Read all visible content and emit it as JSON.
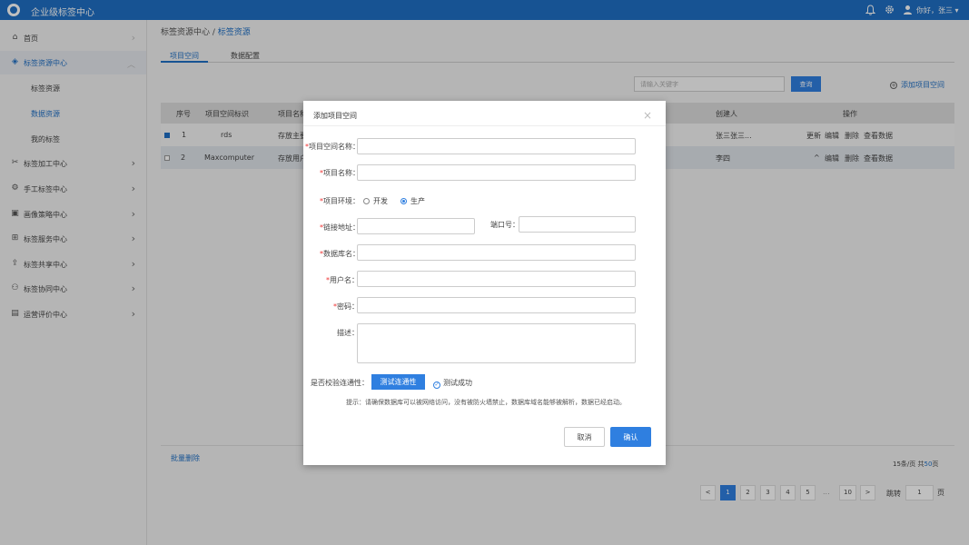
{
  "app": {
    "title": "企业级标签中心",
    "greeting": "你好，张三"
  },
  "sidebar": {
    "items": [
      {
        "label": "首页"
      },
      {
        "label": "标签资源中心"
      },
      {
        "label": "标签加工中心"
      },
      {
        "label": "手工标签中心"
      },
      {
        "label": "画像策略中心"
      },
      {
        "label": "标签服务中心"
      },
      {
        "label": "标签共享中心"
      },
      {
        "label": "标签协同中心"
      },
      {
        "label": "运营评价中心"
      }
    ],
    "sub_items": [
      {
        "label": "标签资源"
      },
      {
        "label": "数据资源"
      },
      {
        "label": "我的标签"
      }
    ]
  },
  "breadcrumb": {
    "parent": "标签资源中心",
    "sep": " / ",
    "current": "标签资源"
  },
  "tabs": [
    {
      "label": "项目空间"
    },
    {
      "label": "数据配置"
    }
  ],
  "search": {
    "placeholder": "请输入关键字",
    "button": "查询"
  },
  "add_button": "添加项目空间",
  "table": {
    "headers": {
      "index": "序号",
      "key": "项目空间标识",
      "name": "项目名称",
      "creator": "创建人",
      "ops": "操作"
    },
    "rows": [
      {
        "index": "1",
        "key": "rds",
        "name": "存放主要",
        "creator": "张三张三...",
        "ops": [
          "更新",
          "编辑",
          "删除",
          "查看数据"
        ],
        "checked": true
      },
      {
        "index": "2",
        "key": "Maxcomputer",
        "name": "存放用户",
        "creator": "李四",
        "ops": [
          "^",
          "编辑",
          "删除",
          "查看数据"
        ],
        "checked": false
      }
    ]
  },
  "batch_delete": "批量删除",
  "pagination": {
    "per_page": "15条/页",
    "total_prefix": "共",
    "total": "50",
    "total_suffix": "页",
    "prev": "<",
    "next": ">",
    "pages": [
      "1",
      "2",
      "3",
      "4",
      "5",
      "10"
    ],
    "dots": "...",
    "current": "1",
    "jump_label": "跳转",
    "jump_value": "1",
    "page_unit": "页"
  },
  "dialog": {
    "title": "添加项目空间",
    "close": "×",
    "fields": {
      "space_name": "项目空间名称：",
      "project_name": "项目名称：",
      "env": "项目环境：",
      "env_dev": "开发",
      "env_prod": "生产",
      "link": "链接地址：",
      "port": "端口号：",
      "db_name": "数据库名：",
      "user": "用户名：",
      "password": "密码：",
      "desc": "描述："
    },
    "required_mark": "*",
    "verify_label": "是否校验连通性：",
    "test_button": "测试连通性",
    "test_result": "测试成功",
    "hint": "提示：请确保数据库可以被网络访问，没有被防火墙禁止，数据库域名能够被解析，数据已经启动。",
    "cancel": "取消",
    "confirm": "确认"
  },
  "colors": {
    "primary": "#1f6fc4",
    "button": "#2f7fe0",
    "required": "#e33333"
  }
}
